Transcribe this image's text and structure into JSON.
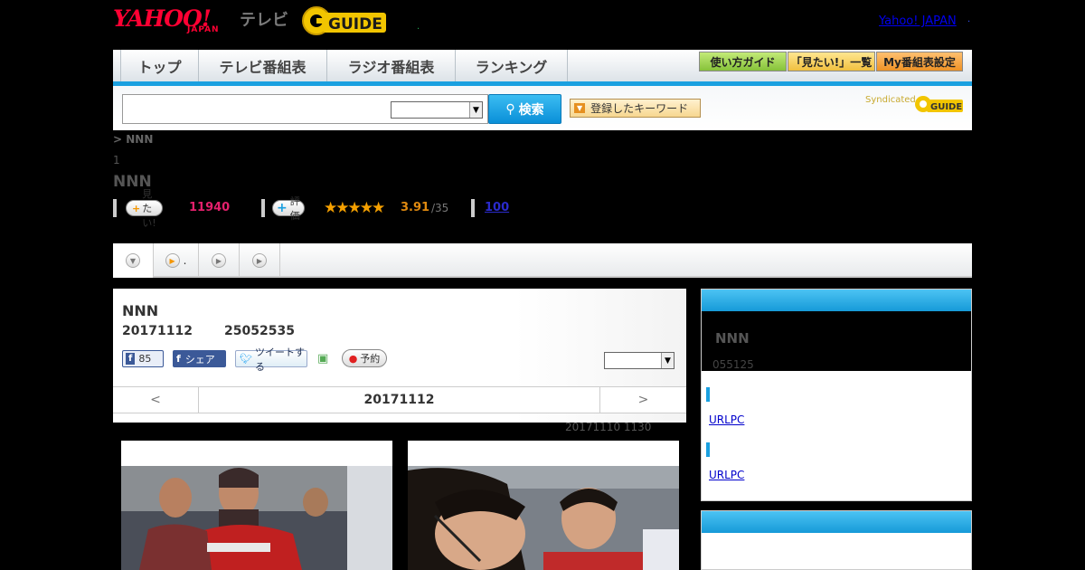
{
  "header": {
    "logo_text": "YAHOO!",
    "logo_sub": "JAPAN",
    "tv_label": "テレビ",
    "gguide_label": "G GUIDE",
    "yahoo_japan_link": "Yahoo! JAPAN",
    "link_sep": "."
  },
  "nav": {
    "tabs": [
      {
        "label": "トップ"
      },
      {
        "label": "テレビ番組表"
      },
      {
        "label": "ラジオ番組表"
      },
      {
        "label": "ランキング"
      }
    ],
    "buttons": [
      {
        "label": "使い方ガイド",
        "color": "#9ad046"
      },
      {
        "label": "「見たい!」一覧",
        "color": "#f6c84a"
      },
      {
        "label": "My番組表設定",
        "color": "#f1a23a"
      }
    ]
  },
  "search": {
    "placeholder": "",
    "button_label": "検索",
    "keyword_button": "登録したキーワード",
    "syndicated": "Syndicated"
  },
  "program": {
    "breadcrumb": "> NNN",
    "episode_num": "1",
    "title": "NNN",
    "want_label": "見たい!",
    "want_count": "11940",
    "rate_label": "評価",
    "stars": "★★★★★",
    "rating": "3.91",
    "rating_of": "/35",
    "reviews": "100"
  },
  "subtabs": [
    {
      "label": ""
    },
    {
      "label": "."
    },
    {
      "label": ""
    },
    {
      "label": ""
    }
  ],
  "card": {
    "title": "NNN",
    "date": "20171112",
    "id": "25052535",
    "like_count": "85",
    "share_label": "シェア",
    "tweet_label": "ツイートする",
    "reserve_label": "予約",
    "prev": "<",
    "nav_date": "20171112",
    "next": ">",
    "updated": "20171110  1130"
  },
  "sidebar": {
    "title": "NNN",
    "time": "055125",
    "link1": "URLPC",
    "link2": "URLPC"
  },
  "colors": {
    "accent": "#1aa0e0",
    "want": "#e4206c",
    "rating": "#e08a10"
  }
}
